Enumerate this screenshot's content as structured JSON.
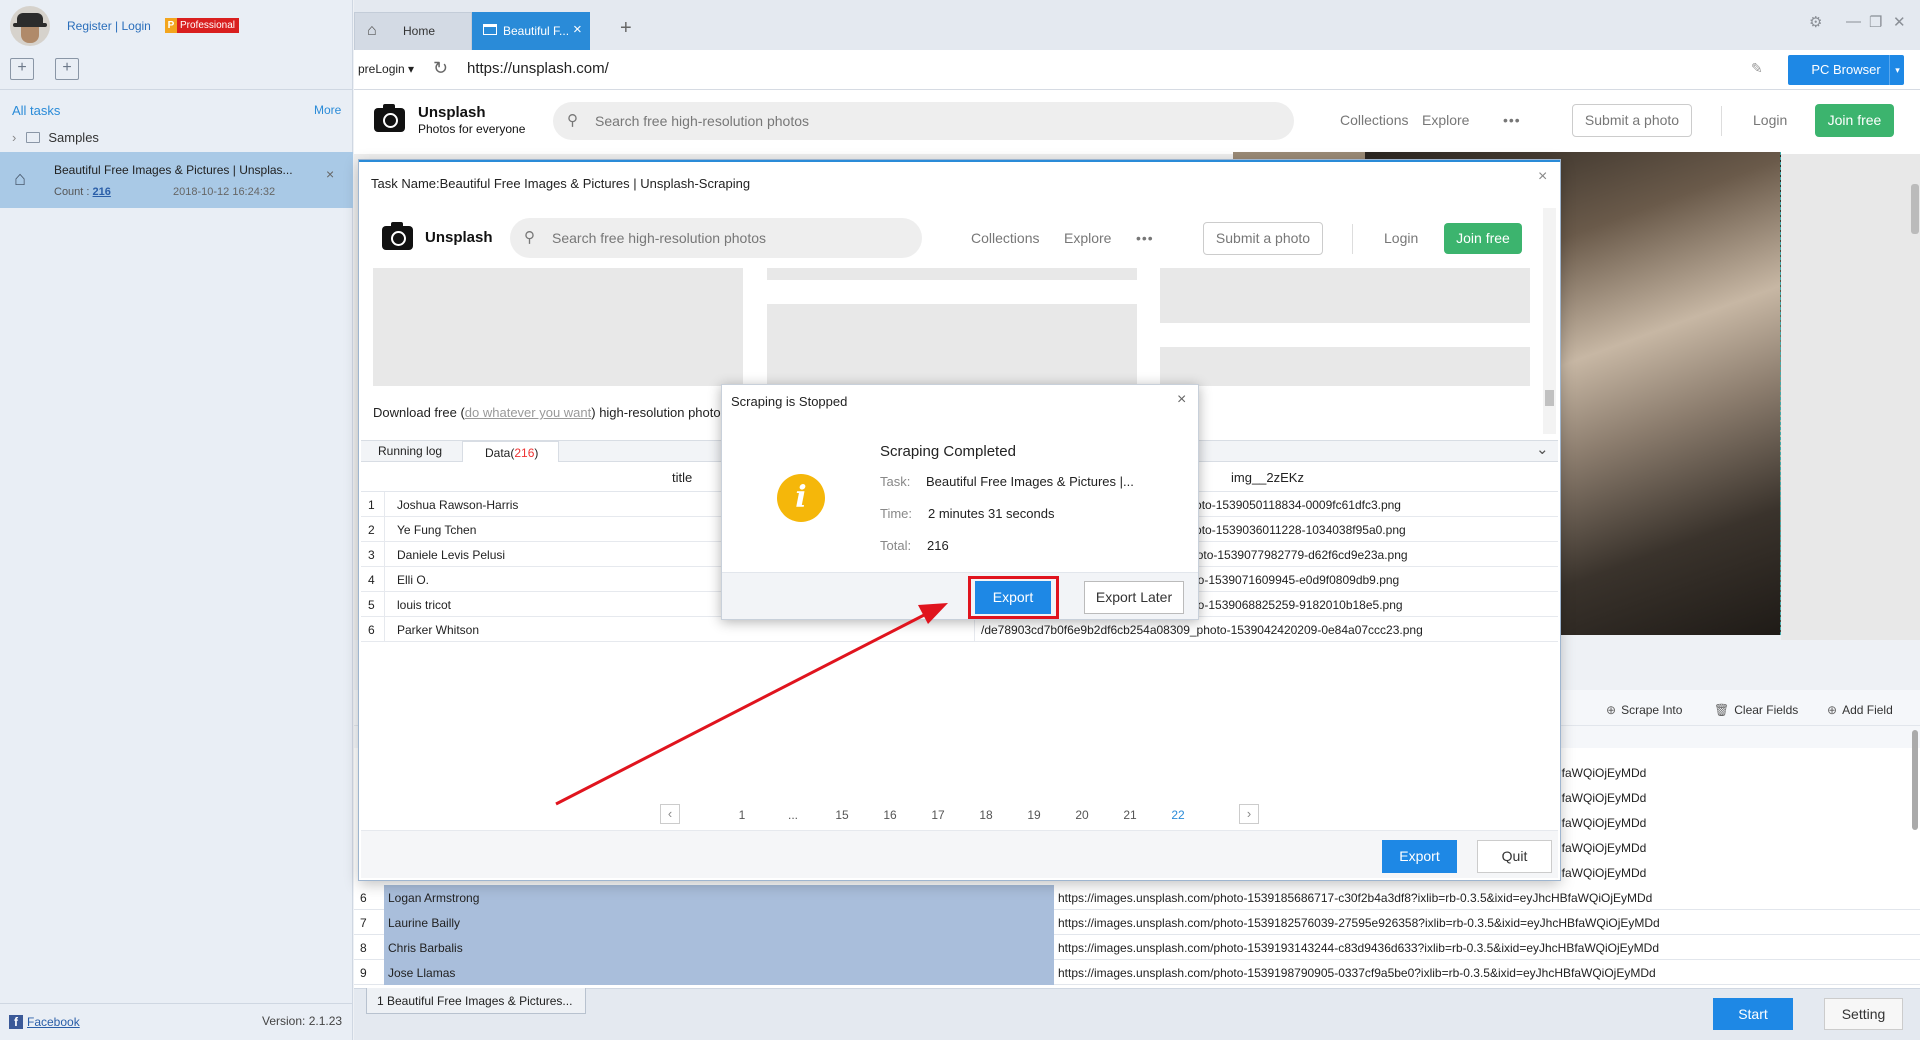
{
  "sidebar": {
    "register_login": "Register | Login",
    "badge_letter": "P",
    "badge_text": "Professional",
    "all_tasks": "All tasks",
    "more": "More",
    "samples": "Samples",
    "task": {
      "title": "Beautiful Free Images & Pictures | Unsplas...",
      "count_label": "Count :",
      "count": "216",
      "date": "2018-10-12 16:24:32"
    },
    "facebook": "Facebook",
    "version": "Version: 2.1.23"
  },
  "tabs": {
    "home": "Home",
    "active": "Beautiful F..."
  },
  "address": {
    "prelogin": "preLogin",
    "url": "https://unsplash.com/",
    "pc_browser": "PC Browser"
  },
  "site": {
    "brand": "Unsplash",
    "tagline": "Photos for everyone",
    "search_placeholder": "Search free high-resolution photos",
    "nav_collections": "Collections",
    "nav_explore": "Explore",
    "nav_more": "•••",
    "submit": "Submit a photo",
    "login": "Login",
    "join": "Join free"
  },
  "task_dialog": {
    "title": "Task Name:Beautiful Free Images & Pictures | Unsplash-Scraping",
    "download_pre": "Download free (",
    "download_link": "do whatever you want",
    "download_post": ") high-resolution photos",
    "tab_running": "Running log",
    "tab_data_label": "Data(",
    "tab_data_count": "216",
    "tab_data_close": ")",
    "col_title": "title",
    "col_img": "img__2zEKz",
    "rows": [
      {
        "num": "1",
        "name": "Joshua Rawson-Harris",
        "url": "_photo-1539050118834-0009fc61dfc3.png"
      },
      {
        "num": "2",
        "name": "Ye Fung Tchen",
        "url": "_photo-1539036011228-1034038f95a0.png"
      },
      {
        "num": "3",
        "name": "Daniele Levis Pelusi",
        "url": "4_photo-1539077982779-d62f6cd9e23a.png"
      },
      {
        "num": "4",
        "name": "Elli O.",
        "url": "hoto-1539071609945-e0d9f0809db9.png"
      },
      {
        "num": "5",
        "name": "louis tricot",
        "url": "hoto-1539068825259-9182010b18e5.png"
      },
      {
        "num": "6",
        "name": "Parker Whitson",
        "url": "/de78903cd7b0f6e9b2df6cb254a08309_photo-1539042420209-0e84a07ccc23.png"
      }
    ],
    "pages": [
      "1",
      "...",
      "15",
      "16",
      "17",
      "18",
      "19",
      "20",
      "21",
      "22"
    ],
    "export": "Export",
    "quit": "Quit"
  },
  "stop_modal": {
    "title": "Scraping is Stopped",
    "heading": "Scraping Completed",
    "task_label": "Task:",
    "task_value": "Beautiful Free Images & Pictures |...",
    "time_label": "Time:",
    "time_value": "2 minutes 31 seconds",
    "total_label": "Total:",
    "total_value": "216",
    "export": "Export",
    "export_later": "Export Later"
  },
  "bg_table": {
    "tools": {
      "scrape_into": "Scrape Into",
      "clear_fields": "Clear Fields",
      "add_field": "Add Field"
    },
    "fragment": "HBfaWQiOjEyMDd",
    "rows": [
      {
        "num": "6",
        "name": "Logan Armstrong",
        "url": "https://images.unsplash.com/photo-1539185686717-c30f2b4a3df8?ixlib=rb-0.3.5&ixid=eyJhcHBfaWQiOjEyMDd"
      },
      {
        "num": "7",
        "name": "Laurine Bailly",
        "url": "https://images.unsplash.com/photo-1539182576039-27595e926358?ixlib=rb-0.3.5&ixid=eyJhcHBfaWQiOjEyMDd"
      },
      {
        "num": "8",
        "name": "Chris Barbalis",
        "url": "https://images.unsplash.com/photo-1539193143244-c83d9436d633?ixlib=rb-0.3.5&ixid=eyJhcHBfaWQiOjEyMDd"
      },
      {
        "num": "9",
        "name": "Jose Llamas",
        "url": "https://images.unsplash.com/photo-1539198790905-0337cf9a5be0?ixlib=rb-0.3.5&ixid=eyJhcHBfaWQiOjEyMDd"
      }
    ]
  },
  "bottom": {
    "task_tab": "1 Beautiful Free Images & Pictures...",
    "start": "Start",
    "setting": "Setting"
  },
  "colors": {
    "accent": "#1e88e5",
    "join": "#3cb46e",
    "highlight": "#e0141e",
    "info": "#f5b70a"
  }
}
